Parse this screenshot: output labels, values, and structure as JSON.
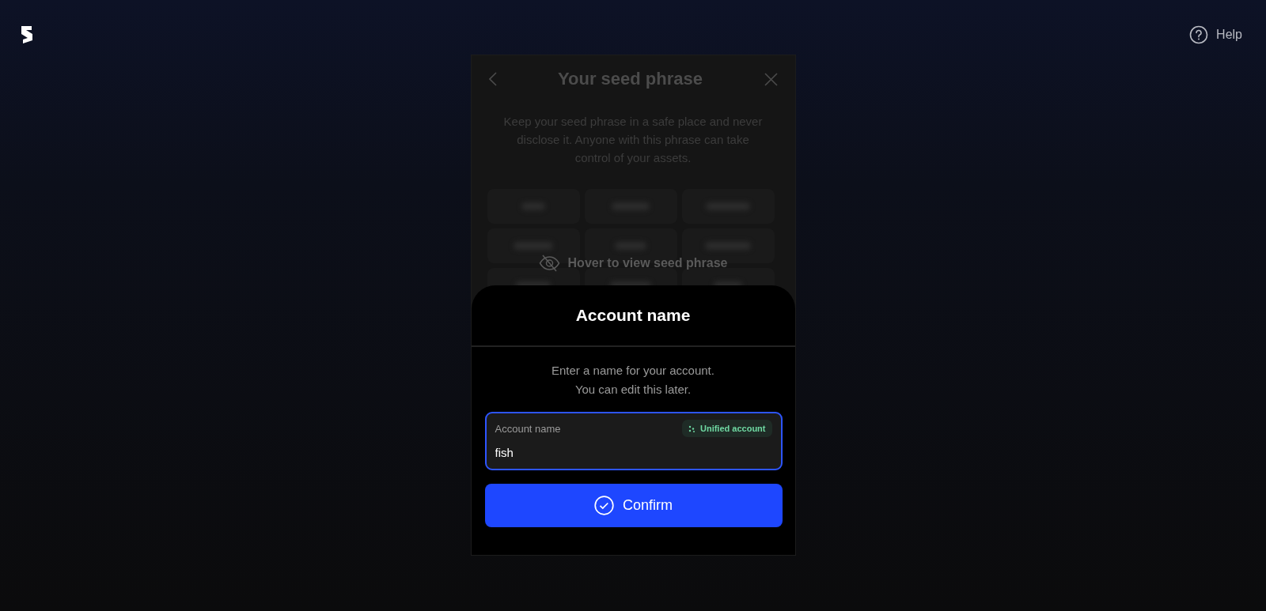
{
  "header": {
    "help_label": "Help"
  },
  "seed_dialog": {
    "title": "Your seed phrase",
    "description": "Keep your seed phrase in a safe place and never disclose it. Anyone with this phrase can take control of your assets.",
    "hover_hint": "Hover to view seed phrase"
  },
  "account_sheet": {
    "title": "Account name",
    "description_lines": [
      "Enter a name for your account.",
      "You can edit this later."
    ],
    "field": {
      "label": "Account name",
      "badge": "Unified account",
      "value": "fish",
      "focused": true
    },
    "confirm_button": "Confirm"
  }
}
